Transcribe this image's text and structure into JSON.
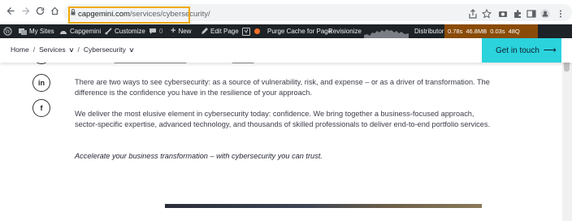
{
  "browser": {
    "url_domain": "capgemini.com",
    "url_path": "/services/cybersecurity/"
  },
  "adminbar": {
    "my_sites": "My Sites",
    "site_name": "Capgemini",
    "customize": "Customize",
    "comments_count": "0",
    "new": "New",
    "edit_page": "Edit Page",
    "purge_cache": "Purge Cache for Page",
    "revisionize": "Revisionize",
    "distributor": "Distributor",
    "perf": [
      "0.78s",
      "46.8MB",
      "0.03s",
      "48Q"
    ]
  },
  "header": {
    "breadcrumb": [
      "Home",
      "Services",
      "Cybersecurity"
    ],
    "cta_label": "Get in touch"
  },
  "social": {
    "linkedin": "in",
    "facebook": "f"
  },
  "content": {
    "para1": "There are two ways to see cybersecurity: as a source of vulnerability, risk, and expense – or as a driver of transformation. The difference is the confidence you have in the resilience of your approach.",
    "para2": "We deliver the most elusive element in cybersecurity today: confidence. We bring together a business-focused approach, sector-specific expertise, advanced technology, and thousands of skilled professionals to deliver end-to-end portfolio services.",
    "para3": "Accelerate your business transformation – with cybersecurity you can trust."
  },
  "colors": {
    "accent_cyan": "#2bd3dd",
    "adminbar_bg": "#1d2327",
    "highlight_box": "#f2a900"
  }
}
